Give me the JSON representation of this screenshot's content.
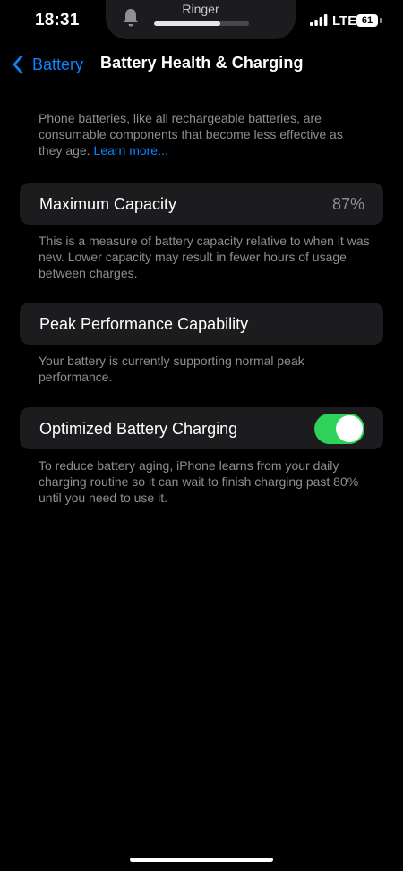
{
  "status_bar": {
    "time": "18:31",
    "ringer_label": "Ringer",
    "ringer_volume_fraction": 0.7,
    "network": "LTE",
    "battery_level": "61"
  },
  "nav": {
    "back_label": "Battery",
    "title": "Battery Health & Charging"
  },
  "intro": {
    "text": "Phone batteries, like all rechargeable batteries, are consumable components that become less effective as they age.",
    "link_label": "Learn more..."
  },
  "maximum_capacity": {
    "label": "Maximum Capacity",
    "value": "87%",
    "footnote": "This is a measure of battery capacity relative to when it was new. Lower capacity may result in fewer hours of usage between charges."
  },
  "peak_performance": {
    "label": "Peak Performance Capability",
    "footnote": "Your battery is currently supporting normal peak performance."
  },
  "optimized_charging": {
    "label": "Optimized Battery Charging",
    "enabled": true,
    "footnote": "To reduce battery aging, iPhone learns from your daily charging routine so it can wait to finish charging past 80% until you need to use it."
  },
  "colors": {
    "accent": "#0a84ff",
    "toggle_on": "#30d158",
    "cell_background": "#1c1c1e",
    "secondary_text": "#8e8e93"
  },
  "icons": {
    "ringer": "bell-icon",
    "signal": "cellular-signal-icon",
    "back": "chevron-left-icon"
  }
}
